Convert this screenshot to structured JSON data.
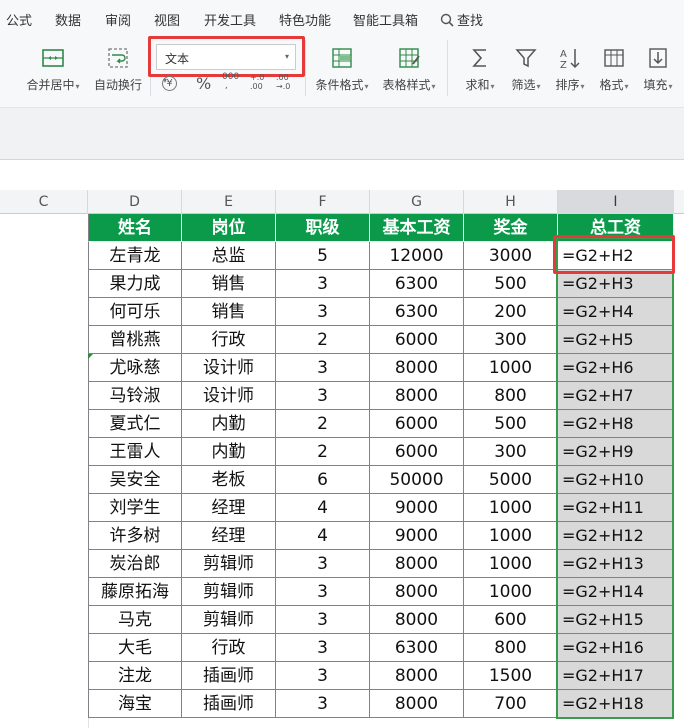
{
  "menubar": {
    "items": [
      "公式",
      "数据",
      "审阅",
      "视图",
      "开发工具",
      "特色功能",
      "智能工具箱",
      "查找"
    ]
  },
  "toolbar": {
    "merge_label": "合并居中",
    "wrap_label": "自动换行",
    "number_format_value": "文本",
    "currency_symbol": "¥",
    "percent_symbol": "%",
    "thousands_symbol": "000",
    "inc_decimal_symbol": "+.0 .00",
    "dec_decimal_symbol": ".00 →.0",
    "cond_format_label": "条件格式",
    "table_style_label": "表格样式",
    "sum_label": "求和",
    "filter_label": "筛选",
    "sort_label": "排序",
    "format_label": "格式",
    "fill_label": "填充"
  },
  "columns": [
    "C",
    "D",
    "E",
    "F",
    "G",
    "H",
    "I"
  ],
  "table": {
    "headers": [
      "姓名",
      "岗位",
      "职级",
      "基本工资",
      "奖金",
      "总工资"
    ],
    "rows": [
      [
        "左青龙",
        "总监",
        "5",
        "12000",
        "3000",
        "=G2+H2"
      ],
      [
        "果力成",
        "销售",
        "3",
        "6300",
        "500",
        "=G2+H3"
      ],
      [
        "何可乐",
        "销售",
        "3",
        "6300",
        "200",
        "=G2+H4"
      ],
      [
        "曾桃燕",
        "行政",
        "2",
        "6000",
        "300",
        "=G2+H5"
      ],
      [
        "尤咏慈",
        "设计师",
        "3",
        "8000",
        "1000",
        "=G2+H6"
      ],
      [
        "马铃淑",
        "设计师",
        "3",
        "8000",
        "800",
        "=G2+H7"
      ],
      [
        "夏式仁",
        "内勤",
        "2",
        "6000",
        "500",
        "=G2+H8"
      ],
      [
        "王雷人",
        "内勤",
        "2",
        "6000",
        "300",
        "=G2+H9"
      ],
      [
        "吴安全",
        "老板",
        "6",
        "50000",
        "5000",
        "=G2+H10"
      ],
      [
        "刘学生",
        "经理",
        "4",
        "9000",
        "1000",
        "=G2+H11"
      ],
      [
        "许多树",
        "经理",
        "4",
        "9000",
        "1000",
        "=G2+H12"
      ],
      [
        "炭治郎",
        "剪辑师",
        "3",
        "8000",
        "1000",
        "=G2+H13"
      ],
      [
        "藤原拓海",
        "剪辑师",
        "3",
        "8000",
        "1000",
        "=G2+H14"
      ],
      [
        "马克",
        "剪辑师",
        "3",
        "8000",
        "600",
        "=G2+H15"
      ],
      [
        "大毛",
        "行政",
        "3",
        "6300",
        "800",
        "=G2+H16"
      ],
      [
        "注龙",
        "插画师",
        "3",
        "8000",
        "1500",
        "=G2+H17"
      ],
      [
        "海宝",
        "插画师",
        "3",
        "8000",
        "700",
        "=G2+H18"
      ]
    ]
  },
  "colors": {
    "header_green": "#0a9a4a",
    "highlight_red": "#e5393a",
    "selection_green": "#3a9a4e"
  }
}
